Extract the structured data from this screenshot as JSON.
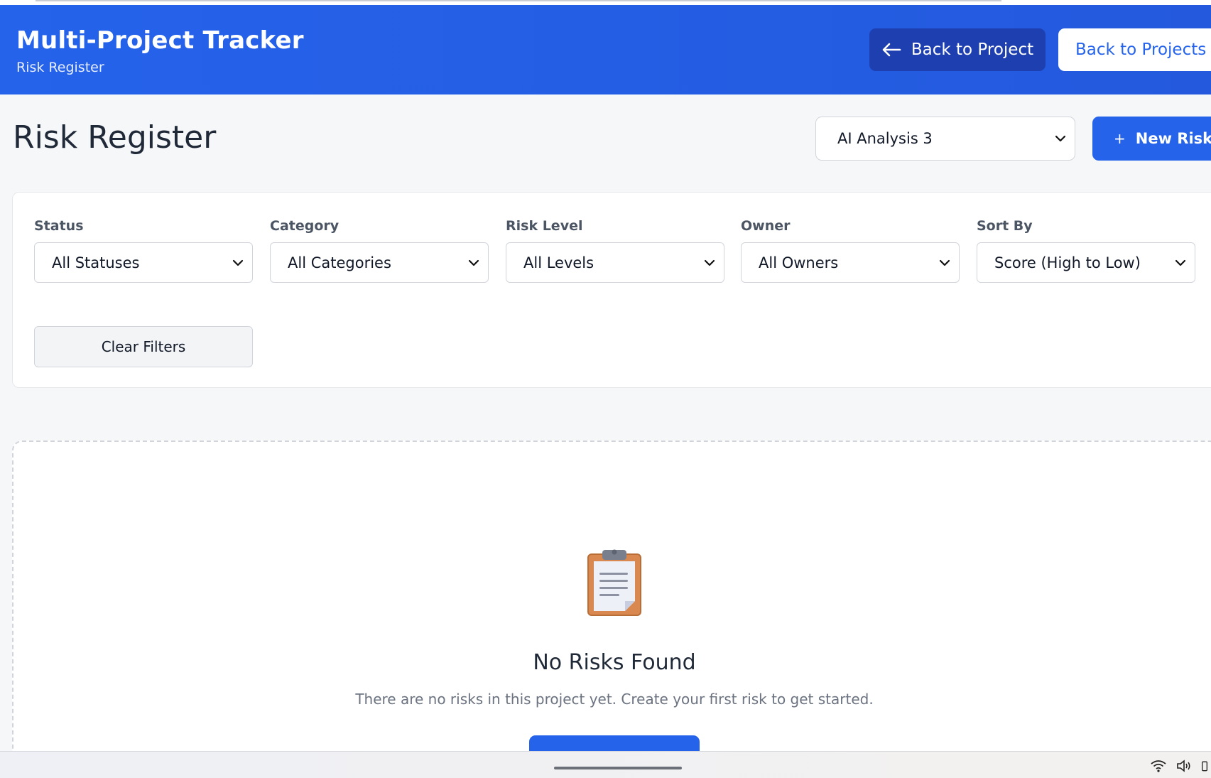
{
  "header": {
    "title": "Multi-Project Tracker",
    "subtitle": "Risk Register",
    "back_to_project": "Back to Project",
    "back_to_projects": "Back to Projects"
  },
  "page": {
    "title": "Risk Register",
    "project_select": "AI Analysis 3",
    "new_risk": "New Risk",
    "new_risk_icon": "+"
  },
  "filters": {
    "status": {
      "label": "Status",
      "value": "All Statuses"
    },
    "category": {
      "label": "Category",
      "value": "All Categories"
    },
    "risk_level": {
      "label": "Risk Level",
      "value": "All Levels"
    },
    "owner": {
      "label": "Owner",
      "value": "All Owners"
    },
    "sort_by": {
      "label": "Sort By",
      "value": "Score (High to Low)"
    },
    "clear": "Clear Filters"
  },
  "empty_state": {
    "icon": "clipboard-icon",
    "title": "No Risks Found",
    "text": "There are no risks in this project yet. Create your first risk to get started."
  },
  "colors": {
    "primary": "#2563eb",
    "primary_dark": "#1d3fb0"
  }
}
